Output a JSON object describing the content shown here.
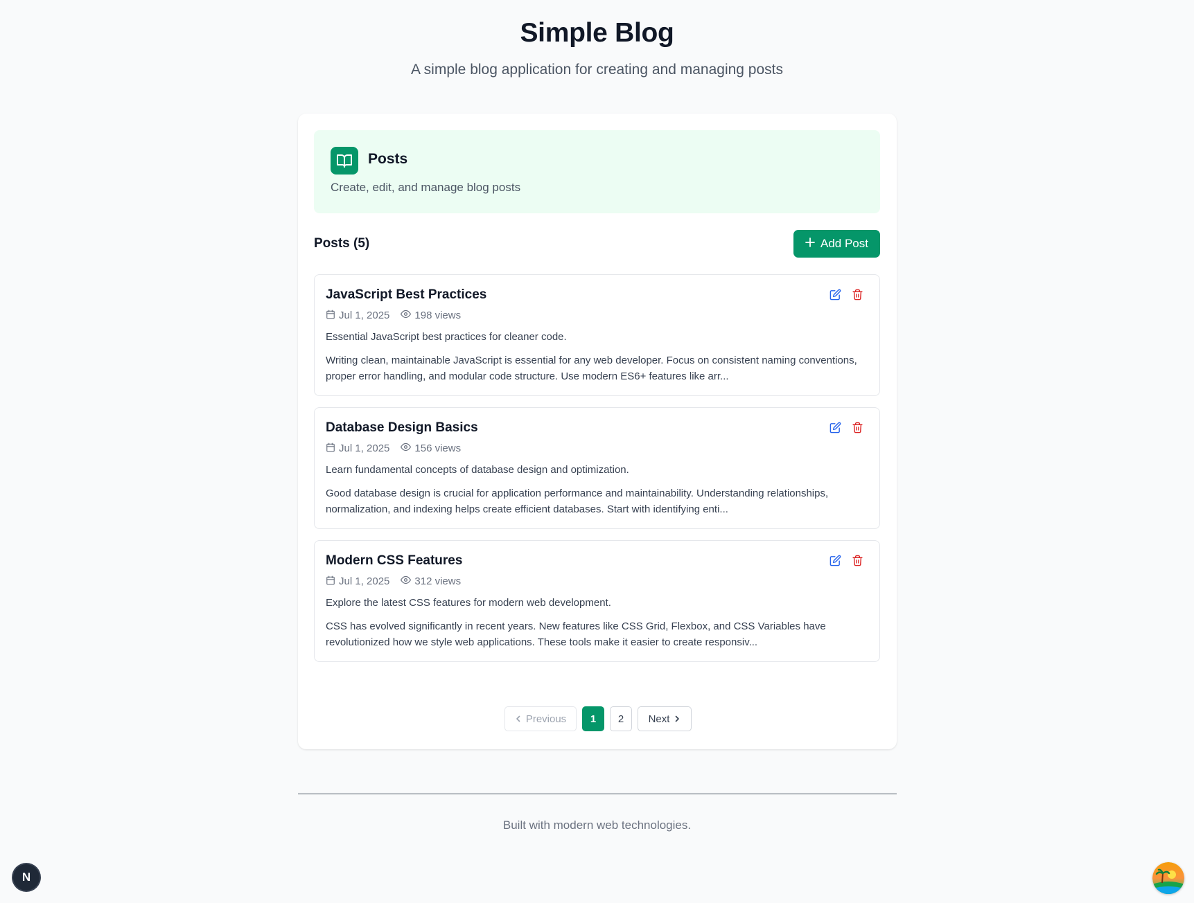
{
  "site": {
    "title": "Simple Blog",
    "subtitle": "A simple blog application for creating and managing posts"
  },
  "posts_panel": {
    "icon": "book-open-icon",
    "title": "Posts",
    "description": "Create, edit, and manage blog posts",
    "count_label": "Posts (5)",
    "add_button_label": "Add Post",
    "accent_color": "#059669",
    "header_bg": "#ecfdf3"
  },
  "posts": [
    {
      "title": "JavaScript Best Practices",
      "date": "Jul 1, 2025",
      "views": "198 views",
      "excerpt": "Essential JavaScript best practices for cleaner code.",
      "body": "Writing clean, maintainable JavaScript is essential for any web developer. Focus on consistent naming conventions, proper error handling, and modular code structure. Use modern ES6+ features like arr..."
    },
    {
      "title": "Database Design Basics",
      "date": "Jul 1, 2025",
      "views": "156 views",
      "excerpt": "Learn fundamental concepts of database design and optimization.",
      "body": "Good database design is crucial for application performance and maintainability. Understanding relationships, normalization, and indexing helps create efficient databases. Start with identifying enti..."
    },
    {
      "title": "Modern CSS Features",
      "date": "Jul 1, 2025",
      "views": "312 views",
      "excerpt": "Explore the latest CSS features for modern web development.",
      "body": "CSS has evolved significantly in recent years. New features like CSS Grid, Flexbox, and CSS Variables have revolutionized how we style web applications. These tools make it easier to create responsiv..."
    }
  ],
  "pagination": {
    "previous_label": "Previous",
    "next_label": "Next",
    "pages": [
      "1",
      "2"
    ],
    "current_page": "1"
  },
  "footer": {
    "text": "Built with modern web technologies."
  },
  "dev_badge": {
    "label": "N"
  },
  "colors": {
    "edit": "#2563eb",
    "delete": "#dc2626"
  }
}
